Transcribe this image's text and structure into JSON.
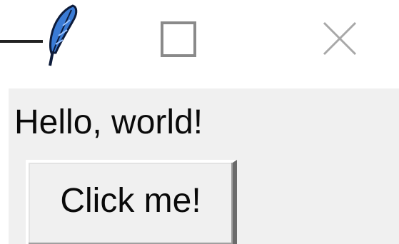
{
  "window": {
    "controls": {
      "minimize_icon": "minimize-icon",
      "app_icon": "feather-icon",
      "maximize_icon": "maximize-icon",
      "close_icon": "close-icon"
    },
    "colors": {
      "titlebar_bg": "#ffffff",
      "client_bg": "#f0f0f0",
      "text": "#0a0a0a",
      "feather_blue": "#3a7bd5"
    }
  },
  "main": {
    "label_text": "Hello, world!",
    "button_label": "Click me!"
  }
}
